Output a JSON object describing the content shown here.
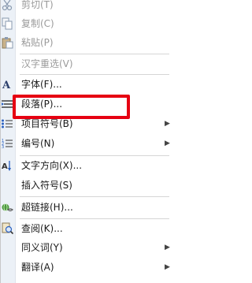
{
  "menu": {
    "items": {
      "cut": {
        "label": "剪切(T)",
        "icon": "scissors-icon",
        "enabled": false
      },
      "copy": {
        "label": "复制(C)",
        "icon": "copy-icon",
        "enabled": false
      },
      "paste": {
        "label": "粘贴(P)",
        "icon": "paste-icon",
        "enabled": false
      },
      "reconvert": {
        "label": "汉字重选(V)",
        "enabled": false
      },
      "font": {
        "label": "字体(F)...",
        "icon": "font-icon",
        "enabled": true
      },
      "paragraph": {
        "label": "段落(P)...",
        "icon": "paragraph-icon",
        "enabled": true
      },
      "bullets": {
        "label": "项目符号(B)",
        "icon": "bullets-icon",
        "enabled": true,
        "submenu": true
      },
      "numbering": {
        "label": "编号(N)",
        "icon": "numbering-icon",
        "enabled": true,
        "submenu": true
      },
      "text_direction": {
        "label": "文字方向(X)...",
        "icon": "text-direction-icon",
        "enabled": true
      },
      "insert_symbol": {
        "label": "插入符号(S)",
        "enabled": true
      },
      "hyperlink": {
        "label": "超链接(H)...",
        "icon": "hyperlink-icon",
        "enabled": true
      },
      "lookup": {
        "label": "查阅(K)...",
        "icon": "lookup-icon",
        "enabled": true
      },
      "synonyms": {
        "label": "同义词(Y)",
        "enabled": true,
        "submenu": true
      },
      "translate": {
        "label": "翻译(A)",
        "enabled": true,
        "submenu": true
      }
    },
    "submenu_arrow": "▶"
  },
  "colors": {
    "highlight": "#e60012",
    "disabled_text": "#9a9a9a",
    "gutter": "#ecf1f7"
  }
}
